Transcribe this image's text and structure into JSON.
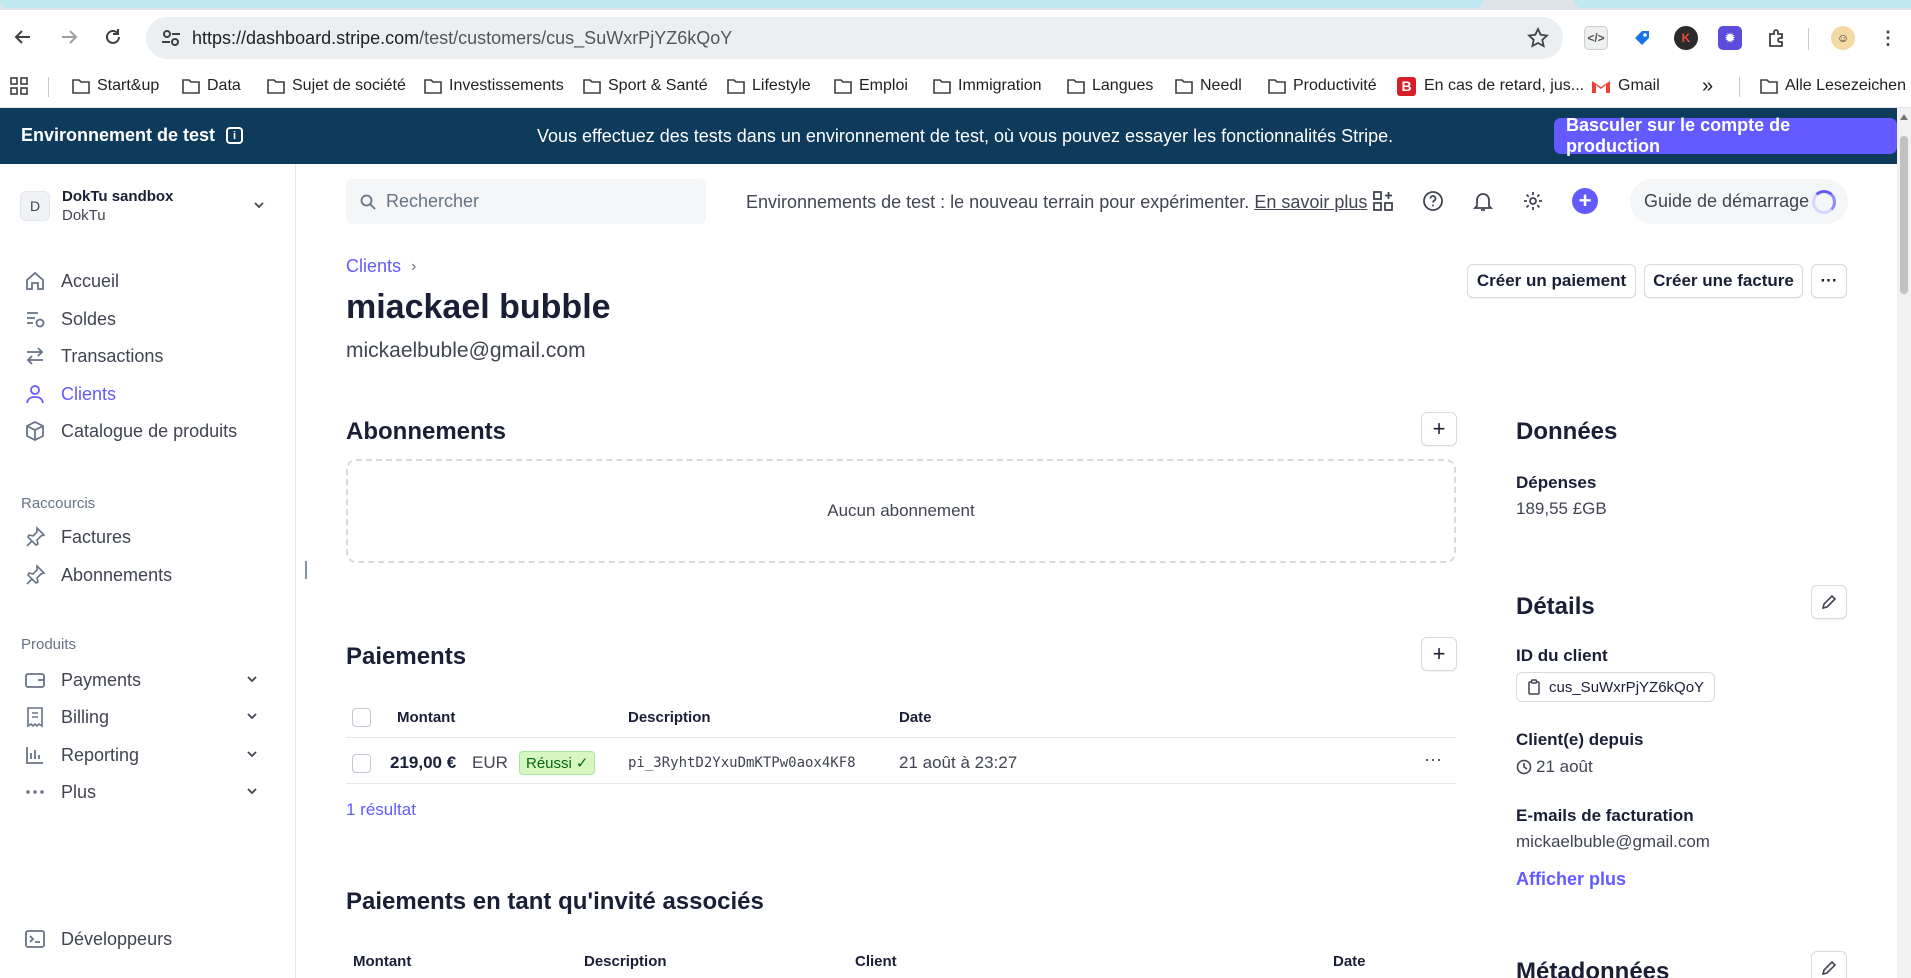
{
  "browser": {
    "url_host": "https://dashboard.stripe.com",
    "url_path": "/test/customers/cus_SuWxrPjYZ6kQoY",
    "bookmarks": [
      "Start&up",
      "Data",
      "Sujet de société",
      "Investissements",
      "Sport & Santé",
      "Lifestyle",
      "Emploi",
      "Immigration",
      "Langues",
      "Needl",
      "Productivité",
      "En cas de retard, jus...",
      "Gmail",
      "Alle Lesezeichen"
    ],
    "overflow": "»"
  },
  "banner": {
    "env_label": "Environnement de test",
    "message": "Vous effectuez des tests dans un environnement de test, où vous pouvez essayer les fonctionnalités Stripe.",
    "switch_label": "Basculer sur le compte de production"
  },
  "account": {
    "initial": "D",
    "name": "DokTu sandbox",
    "sub": "DokTu"
  },
  "sidebar": {
    "main": [
      "Accueil",
      "Soldes",
      "Transactions",
      "Clients",
      "Catalogue de produits"
    ],
    "shortcuts_title": "Raccourcis",
    "shortcuts": [
      "Factures",
      "Abonnements"
    ],
    "products_title": "Produits",
    "products": [
      "Payments",
      "Billing",
      "Reporting",
      "Plus"
    ],
    "developers": "Développeurs"
  },
  "topbar": {
    "search_placeholder": "Rechercher",
    "promo_text": "Environnements de test : le nouveau terrain pour expérimenter.",
    "promo_link": "En savoir plus",
    "guide_label": "Guide de démarrage"
  },
  "customer": {
    "breadcrumb": "Clients",
    "breadcrumb_sep": "›",
    "name": "miackael bubble",
    "email": "mickaelbuble@gmail.com",
    "create_payment": "Créer un paiement",
    "create_invoice": "Créer une facture",
    "more": "···"
  },
  "subscriptions": {
    "title": "Abonnements",
    "empty": "Aucun abonnement",
    "add": "+"
  },
  "payments": {
    "title": "Paiements",
    "add": "+",
    "columns": [
      "Montant",
      "Description",
      "Date"
    ],
    "rows": [
      {
        "amount": "219,00 €",
        "currency": "EUR",
        "status": "Réussi",
        "status_mark": "✓",
        "description": "pi_3RyhtD2YxuDmKTPw0aox4KF8",
        "date": "21 août à 23:27",
        "more": "···"
      }
    ],
    "result_count": "1 résultat"
  },
  "guest_payments": {
    "title": "Paiements en tant qu'invité associés",
    "columns": [
      "Montant",
      "Description",
      "Client",
      "Date"
    ]
  },
  "details_panel": {
    "data_title": "Données",
    "spend_label": "Dépenses",
    "spend_value": "189,55 £GB",
    "details_title": "Détails",
    "id_label": "ID du client",
    "id_value": "cus_SuWxrPjYZ6kQoY",
    "since_label": "Client(e) depuis",
    "since_value": "21 août",
    "billing_label": "E-mails de facturation",
    "billing_value": "mickaelbuble@gmail.com",
    "show_more": "Afficher plus",
    "metadata_title": "Métadonnées"
  },
  "colors": {
    "accent": "#635bff",
    "banner": "#0e3a5c",
    "success_bg": "#d7f7c2",
    "success_text": "#05690d"
  }
}
